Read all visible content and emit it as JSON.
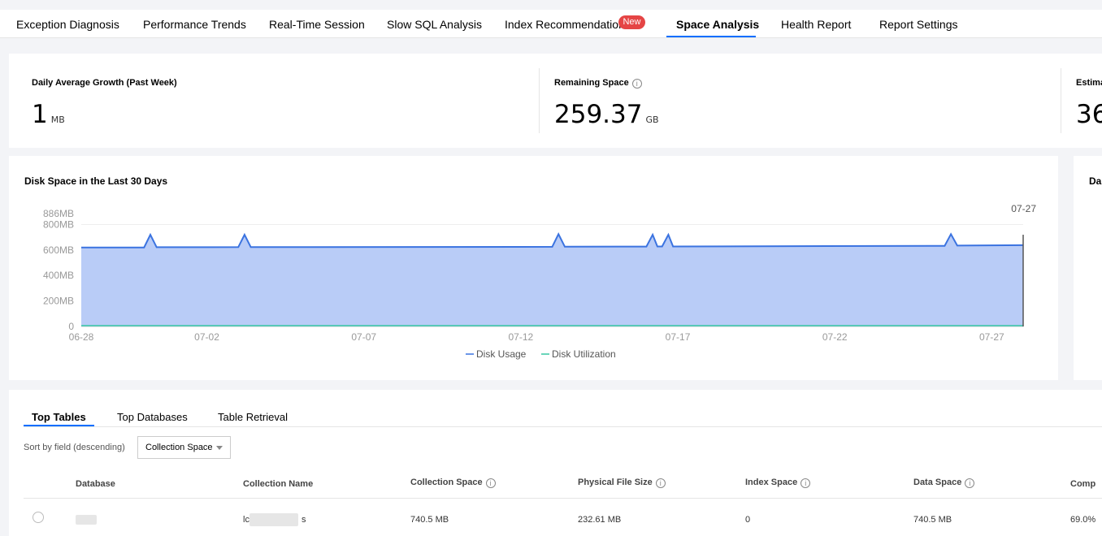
{
  "tabs": [
    {
      "label": "Exception Diagnosis"
    },
    {
      "label": "Performance Trends"
    },
    {
      "label": "Real-Time Session"
    },
    {
      "label": "Slow SQL Analysis"
    },
    {
      "label": "Index Recommendation",
      "badge": "New"
    },
    {
      "label": "Space Analysis",
      "active": true
    },
    {
      "label": "Health Report"
    },
    {
      "label": "Report Settings"
    }
  ],
  "summary": {
    "daily_growth": {
      "label": "Daily Average Growth (Past Week)",
      "value": "1",
      "unit": "MB"
    },
    "remaining": {
      "label": "Remaining Space",
      "value": "259.37",
      "unit": "GB"
    },
    "estimated": {
      "label": "Estima",
      "value": "36"
    }
  },
  "chart_panel": {
    "title": "Disk Space in the Last 30 Days",
    "hover_date": "07-27",
    "right_card_title": "Da"
  },
  "chart_data": {
    "type": "area",
    "title": "Disk Space in the Last 30 Days",
    "y_ticks": [
      "0",
      "200MB",
      "400MB",
      "600MB",
      "800MB",
      "886MB"
    ],
    "x_ticks": [
      "06-28",
      "07-02",
      "07-07",
      "07-12",
      "07-17",
      "07-22",
      "07-27"
    ],
    "ylim": [
      0,
      886
    ],
    "series": [
      {
        "name": "Disk Usage",
        "color": "#3b73e0",
        "fill": "#b9ccf7",
        "points": [
          [
            0,
            620
          ],
          [
            2,
            620
          ],
          [
            2.2,
            720
          ],
          [
            2.4,
            622
          ],
          [
            5,
            623
          ],
          [
            5.2,
            720
          ],
          [
            5.4,
            623
          ],
          [
            15,
            625
          ],
          [
            15.2,
            725
          ],
          [
            15.4,
            626
          ],
          [
            18,
            627
          ],
          [
            18.2,
            720
          ],
          [
            18.35,
            628
          ],
          [
            18.5,
            628
          ],
          [
            18.7,
            720
          ],
          [
            18.85,
            628
          ],
          [
            27.5,
            633
          ],
          [
            27.7,
            725
          ],
          [
            27.9,
            635
          ],
          [
            30,
            638
          ]
        ]
      },
      {
        "name": "Disk Utilization",
        "color": "#38c7a3",
        "values_mb": [
          2,
          2
        ]
      }
    ],
    "legend": [
      "Disk Usage",
      "Disk Utilization"
    ]
  },
  "bottom": {
    "subtabs": [
      {
        "label": "Top Tables",
        "active": true
      },
      {
        "label": "Top Databases"
      },
      {
        "label": "Table Retrieval"
      }
    ],
    "sort_label": "Sort by field (descending)",
    "sort_value": "Collection Space",
    "columns": [
      "Database",
      "Collection Name",
      "Collection Space",
      "Physical File Size",
      "Index Space",
      "Data Space",
      "Comp"
    ],
    "row": {
      "database": "",
      "collection_name_prefix": "lc",
      "collection_name_suffix": "s",
      "collection_space": "740.5 MB",
      "physical_file_size": "232.61 MB",
      "index_space": "0",
      "data_space": "740.5 MB",
      "comp": "69.0%"
    }
  }
}
